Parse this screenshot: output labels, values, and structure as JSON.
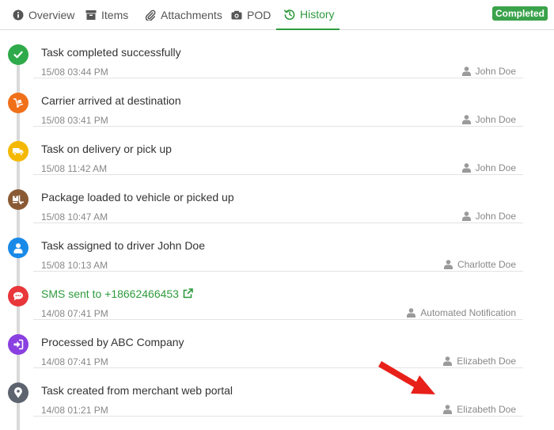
{
  "tabs": [
    {
      "label": "Overview",
      "icon": "info-icon"
    },
    {
      "label": "Items",
      "icon": "box-icon"
    },
    {
      "label": "Attachments",
      "icon": "paperclip-icon"
    },
    {
      "label": "POD",
      "icon": "camera-icon"
    },
    {
      "label": "History",
      "icon": "history-icon",
      "active": true
    }
  ],
  "status_badge": "Completed",
  "colors": {
    "accent": "#2e9b3e",
    "badge": "#3aa24b",
    "completed": "#2faa4a",
    "arrived": "#f07019",
    "delivery": "#f5b800",
    "loaded": "#8a5a35",
    "assigned": "#1a8ae8",
    "sms": "#e8363b",
    "processed": "#8a3fe0",
    "created": "#5d6470",
    "arrow": "#e8201a"
  },
  "history": [
    {
      "title": "Task completed successfully",
      "time": "15/08 03:44 PM",
      "user": "John Doe",
      "icon": "check-icon"
    },
    {
      "title": "Carrier arrived at destination",
      "time": "15/08 03:41 PM",
      "user": "John Doe",
      "icon": "dolly-icon"
    },
    {
      "title": "Task on delivery or pick up",
      "time": "15/08 11:42 AM",
      "user": "John Doe",
      "icon": "truck-icon"
    },
    {
      "title": "Package loaded to vehicle or picked up",
      "time": "15/08 10:47 AM",
      "user": "John Doe",
      "icon": "loading-icon"
    },
    {
      "title": "Task assigned to driver John Doe",
      "time": "15/08 10:13 AM",
      "user": "Charlotte Doe",
      "icon": "person-icon"
    },
    {
      "title": "SMS sent to +18662466453",
      "time": "14/08 07:41 PM",
      "user": "Automated Notification",
      "icon": "chat-icon"
    },
    {
      "title": "Processed by ABC Company",
      "time": "14/08 07:41 PM",
      "user": "Elizabeth Doe",
      "icon": "sign-in-icon"
    },
    {
      "title": "Task created from merchant web portal",
      "time": "14/08 01:21 PM",
      "user": "Elizabeth Doe",
      "icon": "map-pin-icon"
    }
  ]
}
